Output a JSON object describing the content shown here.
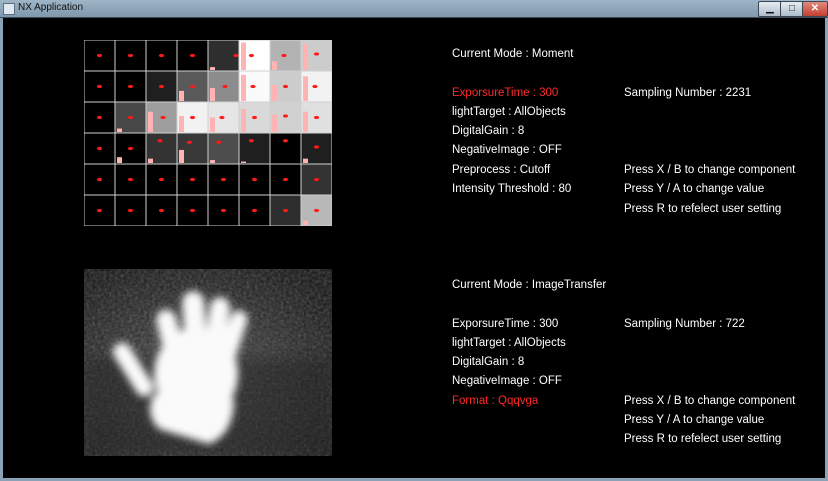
{
  "window": {
    "title": "NX Application",
    "buttons": {
      "minimize": "▁",
      "maximize": "□",
      "close": "✕"
    }
  },
  "colors": {
    "selected": "#ff2a2a",
    "text": "#ffffff",
    "background": "#000000"
  },
  "moment_panel": {
    "current_mode": "Current Mode : Moment",
    "settings": [
      "ExposureTime : 300",
      "lightTarget : AllObjects",
      "DigitalGain : 8",
      "NegativeImage : OFF",
      "Preprocess : Cutoff",
      "Intensity Threshold : 80"
    ],
    "settings_override": [
      "ExporsureTime : 300"
    ],
    "selected_setting_index": 0,
    "sampling": "Sampling Number : 2231",
    "instructions": [
      "Press X / B to change component",
      "Press Y / A to change value",
      "Press R to refelect user setting"
    ],
    "grid": {
      "cols": 8,
      "rows": 6,
      "intensity": [
        [
          0,
          0,
          0,
          0,
          0.18,
          1.0,
          0.7,
          0.8
        ],
        [
          0,
          0,
          0.12,
          0.35,
          0.55,
          0.98,
          0.8,
          0.95
        ],
        [
          0,
          0.28,
          0.62,
          0.95,
          0.9,
          0.85,
          0.82,
          0.88
        ],
        [
          0,
          0,
          0.2,
          0.22,
          0.3,
          0.12,
          0,
          0.12
        ],
        [
          0,
          0,
          0,
          0,
          0,
          0,
          0,
          0.2
        ],
        [
          0,
          0,
          0,
          0,
          0,
          0,
          0.18,
          0.72
        ]
      ],
      "bar_level": [
        [
          0,
          0,
          0,
          0,
          0.1,
          0.95,
          0.3,
          0.9
        ],
        [
          0,
          0,
          0,
          0.35,
          0.45,
          0.9,
          0.55,
          0.85
        ],
        [
          0,
          0.12,
          0.7,
          0.55,
          0.5,
          0.8,
          0.6,
          0.7
        ],
        [
          0,
          0.2,
          0.15,
          0.45,
          0.1,
          0.05,
          0,
          0.15
        ],
        [
          0,
          0,
          0,
          0,
          0,
          0,
          0,
          0
        ],
        [
          0,
          0,
          0,
          0,
          0,
          0,
          0,
          0.15
        ]
      ],
      "centroid_u": [
        [
          0.5,
          0.5,
          0.5,
          0.5,
          0.9,
          0.4,
          0.45,
          0.5
        ],
        [
          0.5,
          0.5,
          0.5,
          0.5,
          0.55,
          0.45,
          0.5,
          0.45
        ],
        [
          0.5,
          0.5,
          0.55,
          0.5,
          0.45,
          0.5,
          0.5,
          0.5
        ],
        [
          0.5,
          0.5,
          0.45,
          0.4,
          0.35,
          0.4,
          0.5,
          0.5
        ],
        [
          0.5,
          0.5,
          0.5,
          0.5,
          0.5,
          0.5,
          0.5,
          0.5
        ],
        [
          0.5,
          0.5,
          0.5,
          0.5,
          0.5,
          0.5,
          0.5,
          0.5
        ]
      ],
      "centroid_v": [
        [
          0.5,
          0.5,
          0.5,
          0.5,
          0.5,
          0.5,
          0.5,
          0.45
        ],
        [
          0.5,
          0.5,
          0.5,
          0.5,
          0.5,
          0.5,
          0.5,
          0.5
        ],
        [
          0.5,
          0.5,
          0.5,
          0.5,
          0.5,
          0.5,
          0.45,
          0.5
        ],
        [
          0.5,
          0.5,
          0.25,
          0.3,
          0.3,
          0.25,
          0.25,
          0.45
        ],
        [
          0.5,
          0.5,
          0.5,
          0.5,
          0.5,
          0.5,
          0.5,
          0.5
        ],
        [
          0.5,
          0.5,
          0.5,
          0.5,
          0.5,
          0.5,
          0.5,
          0.5
        ]
      ]
    }
  },
  "image_panel": {
    "current_mode": "Current Mode : ImageTransfer",
    "settings": [
      "ExporsureTime : 300",
      "lightTarget : AllObjects",
      "DigitalGain : 8",
      "NegativeImage : OFF",
      "Format : Qqqvga"
    ],
    "selected_setting_index": 4,
    "sampling": "Sampling Number : 722",
    "instructions": [
      "Press X / B to change component",
      "Press Y / A to change value",
      "Press R to refelect user setting"
    ]
  }
}
